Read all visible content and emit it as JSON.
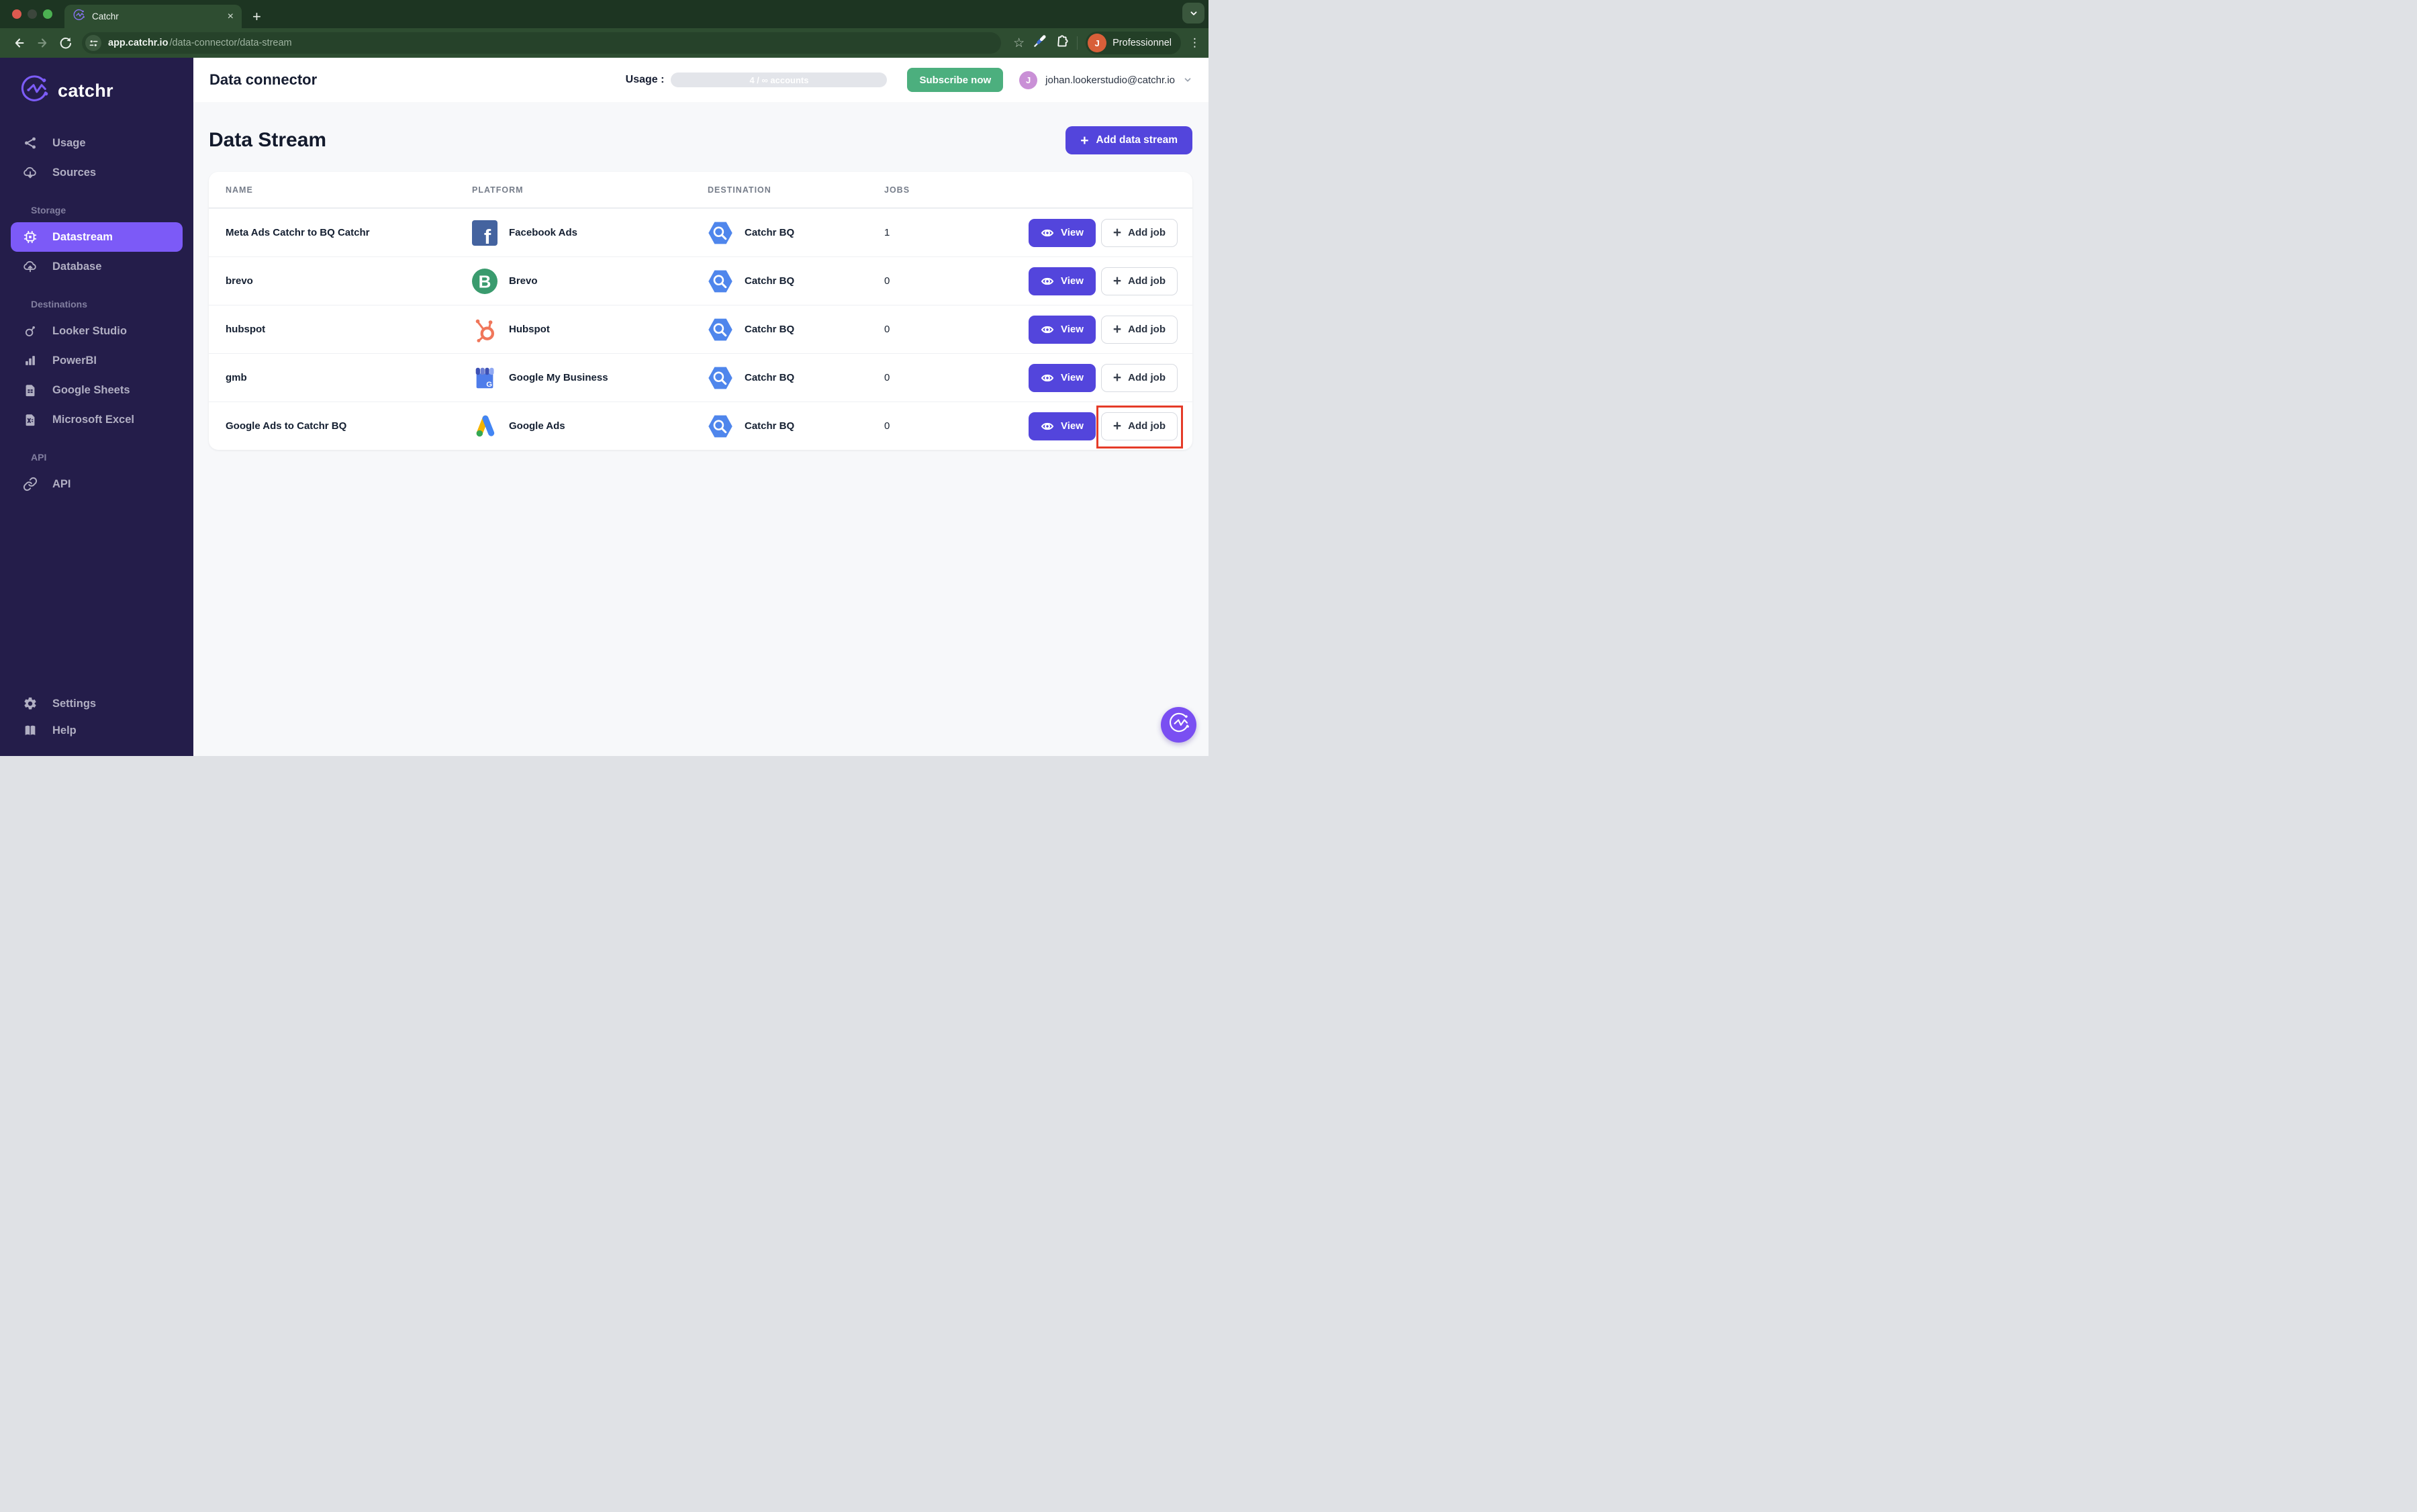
{
  "browser": {
    "tab_title": "Catchr",
    "close_icon": "×",
    "new_tab_icon": "+",
    "menu_icon": "⋮",
    "star_icon": "☆",
    "url_host": "app.catchr.io",
    "url_path": "/data-connector/data-stream",
    "profile_initial": "J",
    "profile_label": "Professionnel"
  },
  "sidebar": {
    "brand": "catchr",
    "sections": {
      "storage": "Storage",
      "destinations": "Destinations",
      "api": "API"
    },
    "items": {
      "usage": "Usage",
      "sources": "Sources",
      "datastream": "Datastream",
      "database": "Database",
      "looker": "Looker Studio",
      "powerbi": "PowerBI",
      "sheets": "Google Sheets",
      "excel": "Microsoft Excel",
      "api": "API",
      "settings": "Settings",
      "help": "Help"
    }
  },
  "header": {
    "title": "Data connector",
    "usage_label": "Usage :",
    "usage_value": "4 / ∞ accounts",
    "subscribe_label": "Subscribe now",
    "avatar_initial": "J",
    "account_email": "johan.lookerstudio@catchr.io"
  },
  "page": {
    "title": "Data Stream",
    "add_stream_label": "Add data stream",
    "add_icon": "+"
  },
  "table": {
    "columns": [
      "NAME",
      "PLATFORM",
      "DESTINATION",
      "JOBS"
    ],
    "view_label": "View",
    "add_job_label": "Add job",
    "rows": [
      {
        "name": "Meta Ads Catchr to BQ Catchr",
        "platform": "Facebook Ads",
        "destination": "Catchr BQ",
        "jobs": "1",
        "highlighted": false
      },
      {
        "name": "brevo",
        "platform": "Brevo",
        "destination": "Catchr BQ",
        "jobs": "0",
        "highlighted": false
      },
      {
        "name": "hubspot",
        "platform": "Hubspot",
        "destination": "Catchr BQ",
        "jobs": "0",
        "highlighted": false
      },
      {
        "name": "gmb",
        "platform": "Google My Business",
        "destination": "Catchr BQ",
        "jobs": "0",
        "highlighted": false
      },
      {
        "name": "Google Ads to Catchr BQ",
        "platform": "Google Ads",
        "destination": "Catchr BQ",
        "jobs": "0",
        "highlighted": true
      }
    ]
  },
  "colors": {
    "accent": "#5345dc",
    "sidebar_active": "#7c5af7",
    "subscribe_green": "#4caf7e",
    "highlight_red": "#e53b28",
    "chrome_green": "#2e4d31",
    "sidebar_bg": "#241d4a"
  }
}
